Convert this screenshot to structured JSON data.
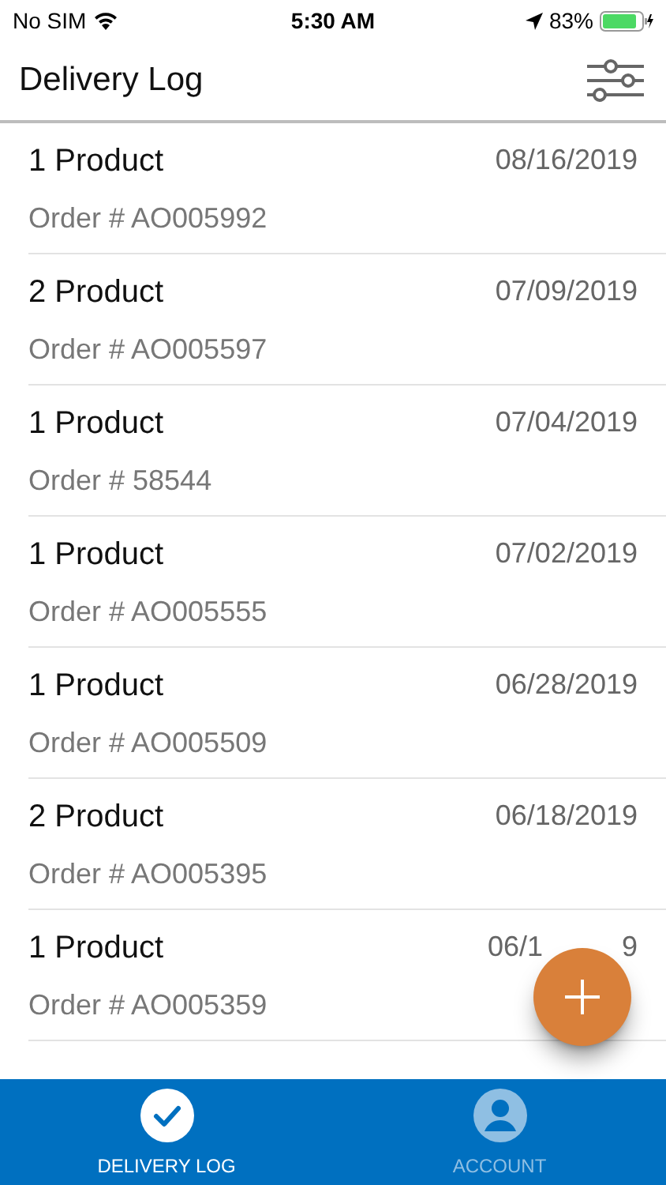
{
  "status_bar": {
    "carrier": "No SIM",
    "time": "5:30 AM",
    "battery": "83%"
  },
  "header": {
    "title": "Delivery Log"
  },
  "orders": [
    {
      "title": "1 Product",
      "order": "Order # AO005992",
      "date": "08/16/2019"
    },
    {
      "title": "2 Product",
      "order": "Order # AO005597",
      "date": "07/09/2019"
    },
    {
      "title": "1 Product",
      "order": "Order # 58544",
      "date": "07/04/2019"
    },
    {
      "title": "1 Product",
      "order": "Order # AO005555",
      "date": "07/02/2019"
    },
    {
      "title": "1 Product",
      "order": "Order # AO005509",
      "date": "06/28/2019"
    },
    {
      "title": "2 Product",
      "order": "Order # AO005395",
      "date": "06/18/2019"
    },
    {
      "title": "1 Product",
      "order": "Order # AO005359",
      "date": "06/1",
      "date_end": "9"
    }
  ],
  "tabs": [
    {
      "label": "DELIVERY LOG",
      "kind": "check",
      "selected": true
    },
    {
      "label": "ACCOUNT",
      "kind": "person",
      "selected": false
    }
  ]
}
